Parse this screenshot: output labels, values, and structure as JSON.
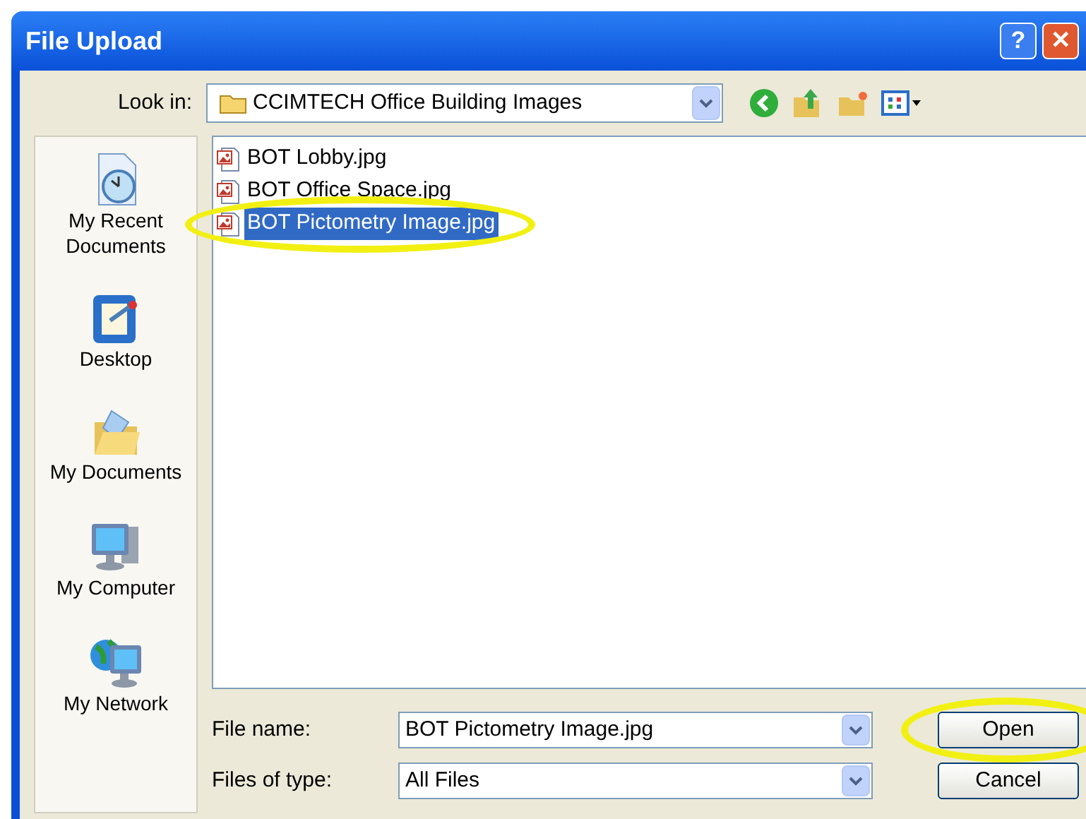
{
  "window": {
    "title": "File Upload",
    "title_buttons": [
      "?",
      "✕"
    ]
  },
  "look_in": {
    "label": "Look in:",
    "value": "CCIMTECH Office Building Images"
  },
  "places": [
    {
      "label": "My Recent Documents",
      "kind": "recent"
    },
    {
      "label": "Desktop",
      "kind": "desktop"
    },
    {
      "label": "My Documents",
      "kind": "documents"
    },
    {
      "label": "My Computer",
      "kind": "computer"
    },
    {
      "label": "My Network",
      "kind": "network"
    }
  ],
  "files": [
    {
      "name": "BOT Lobby.jpg",
      "selected": false,
      "highlighted": false
    },
    {
      "name": "BOT Office Space.jpg",
      "selected": false,
      "highlighted": false
    },
    {
      "name": "BOT Pictometry Image.jpg",
      "selected": true,
      "highlighted": true
    }
  ],
  "file_name": {
    "label": "File name:",
    "value": "BOT Pictometry Image.jpg"
  },
  "file_type": {
    "label": "Files of type:",
    "value": "All Files"
  },
  "buttons": [
    {
      "label": "Open",
      "highlighted": true
    },
    {
      "label": "Cancel",
      "highlighted": false
    }
  ]
}
